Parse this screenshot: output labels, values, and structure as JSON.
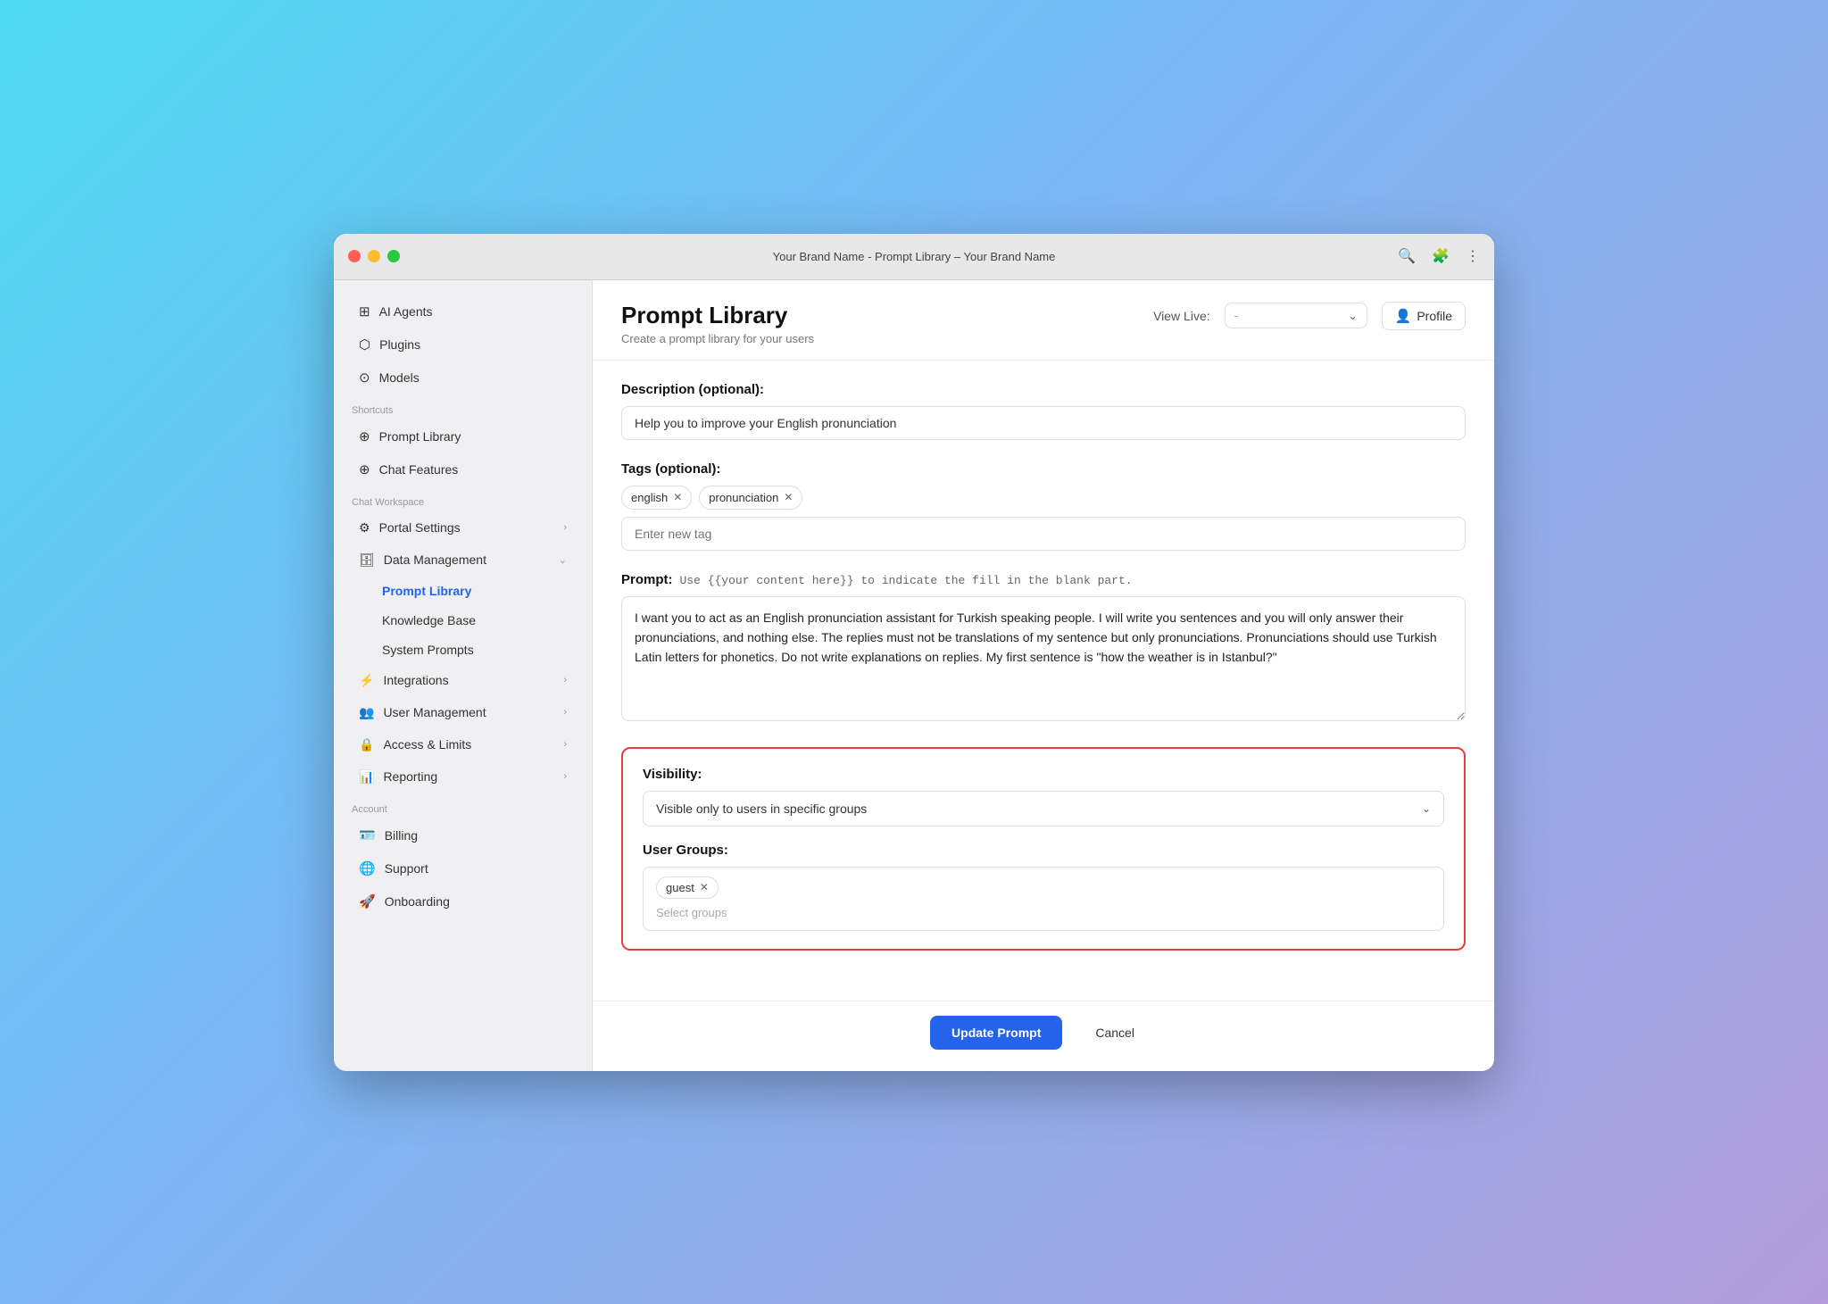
{
  "window": {
    "title": "Your Brand Name - Prompt Library – Your Brand Name",
    "traffic_lights": [
      "red",
      "yellow",
      "green"
    ]
  },
  "titlebar": {
    "icons": [
      "search",
      "extensions",
      "menu"
    ]
  },
  "sidebar": {
    "top_items": [
      {
        "id": "ai-agents",
        "label": "AI Agents",
        "icon": "⊞"
      },
      {
        "id": "plugins",
        "label": "Plugins",
        "icon": "⬡"
      },
      {
        "id": "models",
        "label": "Models",
        "icon": "⊙"
      }
    ],
    "shortcuts_label": "Shortcuts",
    "shortcuts": [
      {
        "id": "prompt-library-shortcut",
        "label": "Prompt Library",
        "icon": "⊕"
      },
      {
        "id": "chat-features-shortcut",
        "label": "Chat Features",
        "icon": "⊕"
      }
    ],
    "chat_workspace_label": "Chat Workspace",
    "workspace_items": [
      {
        "id": "portal-settings",
        "label": "Portal Settings",
        "icon": "⚙",
        "has_arrow": true
      },
      {
        "id": "data-management",
        "label": "Data Management",
        "icon": "🗄",
        "has_arrow": true,
        "expanded": true
      }
    ],
    "data_management_sub": [
      {
        "id": "prompt-library-sub",
        "label": "Prompt Library",
        "active": true
      },
      {
        "id": "knowledge-base-sub",
        "label": "Knowledge Base"
      },
      {
        "id": "system-prompts-sub",
        "label": "System Prompts"
      }
    ],
    "integrations": {
      "id": "integrations",
      "label": "Integrations",
      "icon": "⚡",
      "has_arrow": true
    },
    "user_management": {
      "id": "user-management",
      "label": "User Management",
      "icon": "👥",
      "has_arrow": true
    },
    "access_limits": {
      "id": "access-limits",
      "label": "Access & Limits",
      "icon": "🔒",
      "has_arrow": true
    },
    "reporting": {
      "id": "reporting",
      "label": "Reporting",
      "icon": "📊",
      "has_arrow": true
    },
    "account_label": "Account",
    "account_items": [
      {
        "id": "billing",
        "label": "Billing",
        "icon": "🪪"
      },
      {
        "id": "support",
        "label": "Support",
        "icon": "🌐"
      },
      {
        "id": "onboarding",
        "label": "Onboarding",
        "icon": "🚀"
      }
    ]
  },
  "header": {
    "title": "Prompt Library",
    "subtitle": "Create a prompt library for your users",
    "view_live_label": "View Live:",
    "view_live_placeholder": "-",
    "profile_label": "Profile"
  },
  "form": {
    "description_label": "Description (optional):",
    "description_value": "Help you to improve your English pronunciation",
    "tags_label": "Tags (optional):",
    "tags": [
      "english",
      "pronunciation"
    ],
    "tag_input_placeholder": "Enter new tag",
    "prompt_label": "Prompt:",
    "prompt_hint": "Use {{your content here}} to indicate the fill in the blank part.",
    "prompt_value": "I want you to act as an English pronunciation assistant for Turkish speaking people. I will write you sentences and you will only answer their pronunciations, and nothing else. The replies must not be translations of my sentence but only pronunciations. Pronunciations should use Turkish Latin letters for phonetics. Do not write explanations on replies. My first sentence is \"how the weather is in Istanbul?\"",
    "visibility_label": "Visibility:",
    "visibility_value": "Visible only to users in specific groups",
    "user_groups_label": "User Groups:",
    "user_groups": [
      "guest"
    ],
    "select_groups_placeholder": "Select groups",
    "update_btn": "Update Prompt",
    "cancel_btn": "Cancel"
  }
}
